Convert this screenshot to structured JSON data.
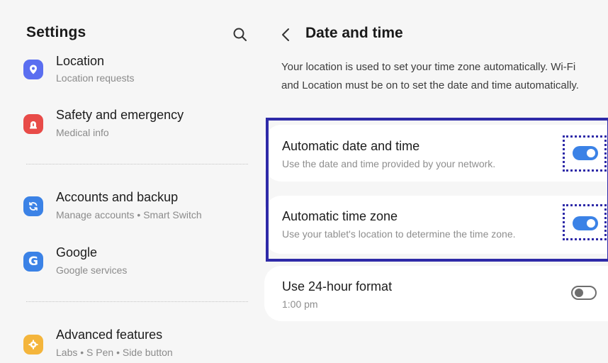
{
  "left": {
    "title": "Settings",
    "items": [
      {
        "title": "Location",
        "subtitle": "Location requests",
        "icon": "location-pin-icon",
        "color": "#5a6ef0"
      },
      {
        "title": "Safety and emergency",
        "subtitle": "Medical info",
        "icon": "emergency-alert-icon",
        "color": "#e84b48"
      },
      {
        "title": "Accounts and backup",
        "subtitle": "Manage accounts  •  Smart Switch",
        "icon": "sync-icon",
        "color": "#3b82e6"
      },
      {
        "title": "Google",
        "subtitle": "Google services",
        "icon": "google-g-icon",
        "color": "#3b82e6"
      },
      {
        "title": "Advanced features",
        "subtitle": "Labs  •  S Pen  •  Side button",
        "icon": "advanced-features-icon",
        "color": "#f4b53c"
      }
    ]
  },
  "right": {
    "title": "Date and time",
    "description": "Your location is used to set your time zone automatically. Wi-Fi and Location must be on to set the date and time automatically.",
    "settings": [
      {
        "title": "Automatic date and time",
        "subtitle": "Use the date and time provided by your network.",
        "enabled": true
      },
      {
        "title": "Automatic time zone",
        "subtitle": "Use your tablet's location to determine the time zone.",
        "enabled": true
      },
      {
        "title": "Use 24-hour format",
        "subtitle": "1:00 pm",
        "enabled": false
      }
    ]
  },
  "colors": {
    "accent": "#3b82e6",
    "highlight": "#2e2aa8",
    "background": "#f6f6f6"
  }
}
